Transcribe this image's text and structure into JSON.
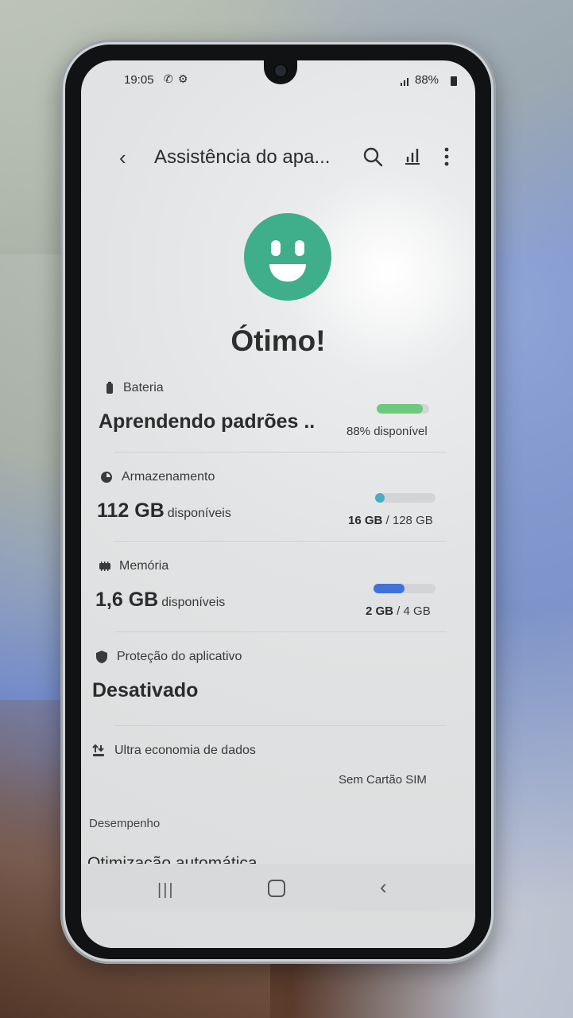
{
  "status_bar": {
    "time": "19:05",
    "battery_percent": "88%"
  },
  "app_bar": {
    "title": "Assistência do apa..."
  },
  "overview": {
    "headline": "Ótimo!"
  },
  "battery": {
    "label": "Bateria",
    "value": "Aprendendo padrões ..",
    "detail": "88% disponível",
    "level": 0.88,
    "color": "#6cc97f"
  },
  "storage": {
    "label": "Armazenamento",
    "value": "112 GB",
    "suffix": "disponíveis",
    "used": "16 GB",
    "separator": " / ",
    "total": "128 GB",
    "used_fraction": 0.125,
    "color": "#4aaec1"
  },
  "memory": {
    "label": "Memória",
    "value": "1,6 GB",
    "suffix": "disponíveis",
    "used": "2 GB",
    "separator": " / ",
    "total": "4 GB",
    "used_fraction": 0.5,
    "color": "#3f73d9"
  },
  "app_protection": {
    "label": "Proteção do aplicativo",
    "value": "Desativado"
  },
  "data_saver": {
    "label": "Ultra economia de dados",
    "detail": "Sem Cartão SIM"
  },
  "performance": {
    "section_label": "Desempenho",
    "item": "Otimização automática"
  },
  "colors": {
    "accent_green": "#3fae8a"
  }
}
